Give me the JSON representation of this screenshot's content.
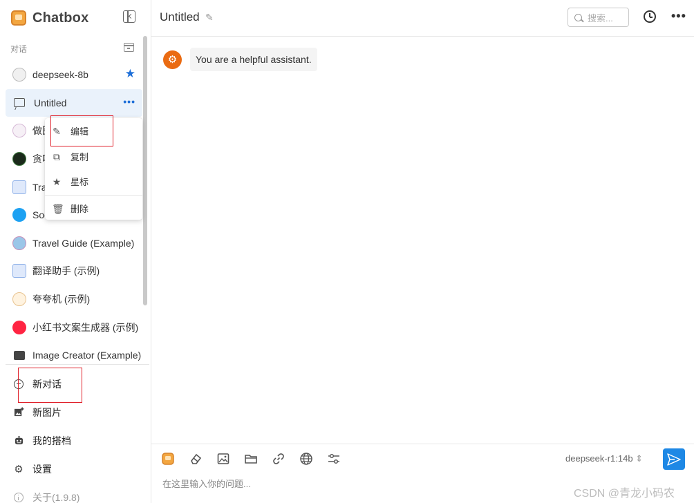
{
  "app": {
    "name": "Chatbox",
    "version_label": "关于(1.9.8)"
  },
  "sidebar": {
    "section_label": "对话",
    "conversations": [
      {
        "label": "deepseek-8b",
        "starred": true
      },
      {
        "label": "Untitled",
        "active": true
      },
      {
        "label": "做图"
      },
      {
        "label": "贪吃"
      },
      {
        "label": "Tra"
      },
      {
        "label": "Soc"
      },
      {
        "label": "Travel Guide (Example)"
      },
      {
        "label": "翻译助手 (示例)"
      },
      {
        "label": "夸夸机 (示例)"
      },
      {
        "label": "小红书文案生成器 (示例)"
      },
      {
        "label": "Image Creator (Example)"
      }
    ],
    "actions": [
      {
        "label": "新对话"
      },
      {
        "label": "新图片"
      },
      {
        "label": "我的搭档"
      },
      {
        "label": "设置"
      }
    ]
  },
  "context_menu": {
    "items": [
      {
        "label": "编辑",
        "icon": "pencil-icon"
      },
      {
        "label": "复制",
        "icon": "copy-icon"
      },
      {
        "label": "星标",
        "icon": "star-icon"
      },
      {
        "label": "删除",
        "icon": "trash-icon"
      }
    ]
  },
  "header": {
    "title": "Untitled",
    "search_placeholder": "搜索..."
  },
  "chat": {
    "system_message": "You are a helpful assistant."
  },
  "composer": {
    "model": "deepseek-r1:14b",
    "placeholder": "在这里输入你的问题..."
  },
  "watermark": "CSDN @青龙小码农",
  "colors": {
    "accent": "#1e88e5",
    "highlight_box": "#e0202a",
    "system_avatar": "#ea6b12"
  }
}
